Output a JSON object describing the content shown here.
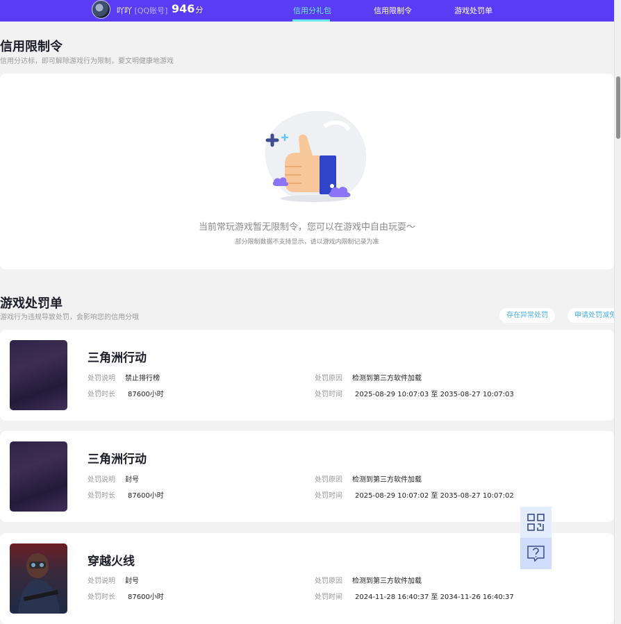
{
  "header": {
    "username": "吖吖",
    "account_tag": "[QQ账号]",
    "score": "946",
    "score_unit": "分",
    "nav": [
      "信用分礼包",
      "信用限制令",
      "游戏处罚单"
    ],
    "accent": "#5b3cf5",
    "active_color": "#6fe7ff"
  },
  "restriction": {
    "title": "信用限制令",
    "subtitle": "信用分达标，即可解除游戏行为限制，要文明健康地游戏",
    "empty_message": "当前常玩游戏暂无限制令，您可以在游戏中自由玩耍～",
    "empty_note": "部分限制数据不支持显示，请以游戏内限制记录为准"
  },
  "penalty": {
    "title": "游戏处罚单",
    "subtitle": "游戏行为违规导致处罚，会影响您的信用分哦",
    "btn_abnormal": "存在异常处罚",
    "btn_reduce": "申请处罚减免",
    "labels": {
      "desc": "处罚说明",
      "duration": "处罚时长",
      "reason": "处罚原因",
      "time": "处罚时间"
    },
    "items": [
      {
        "game": "三角洲行动",
        "desc": "禁止排行榜",
        "duration": "87600小时",
        "reason": "检测到第三方软件加载",
        "time": "2025-08-29 10:07:03 至 2035-08-27 10:07:03"
      },
      {
        "game": "三角洲行动",
        "desc": "封号",
        "duration": "87600小时",
        "reason": "检测到第三方软件加载",
        "time": "2025-08-29 10:07:02 至 2035-08-27 10:07:02"
      },
      {
        "game": "穿越火线",
        "desc": "封号",
        "duration": "87600小时",
        "reason": "检测到第三方软件加载",
        "time": "2024-11-28 16:40:37 至 2034-11-26 16:40:37"
      }
    ]
  },
  "floating": {
    "qr_icon": "qr-code-icon",
    "help_icon": "help-chat-icon"
  }
}
